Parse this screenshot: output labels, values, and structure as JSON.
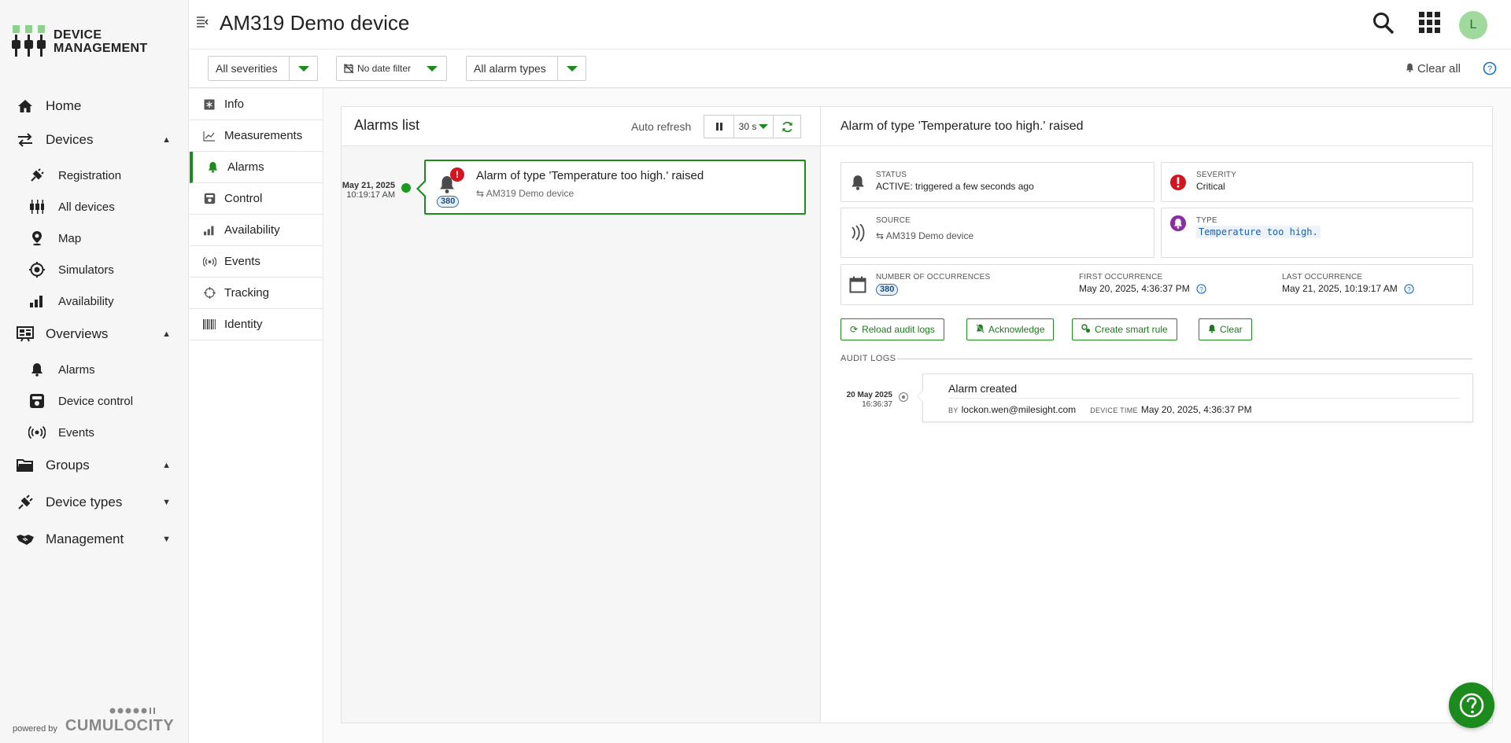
{
  "brand": {
    "line1": "DEVICE",
    "line2": "MANAGEMENT",
    "logo_color": "#8cd28c",
    "powered_by": "powered by",
    "powered_brand": "CUMULOCITY"
  },
  "nav": {
    "home": "Home",
    "devices": "Devices",
    "devices_sub": [
      "Registration",
      "All devices",
      "Map",
      "Simulators",
      "Availability"
    ],
    "overviews": "Overviews",
    "overviews_sub": [
      "Alarms",
      "Device control",
      "Events"
    ],
    "groups": "Groups",
    "device_types": "Device types",
    "management": "Management"
  },
  "header": {
    "title": "AM319 Demo device",
    "avatar_initial": "L",
    "icons": [
      "sidebar-collapse-icon",
      "search-icon",
      "app-grid-icon"
    ]
  },
  "filters": {
    "severity": "All severities",
    "date": "No date filter",
    "alarm_types": "All alarm types",
    "clear_all": "Clear all"
  },
  "tabs": [
    "Info",
    "Measurements",
    "Alarms",
    "Control",
    "Availability",
    "Events",
    "Tracking",
    "Identity"
  ],
  "active_tab": "Alarms",
  "alarms_list": {
    "title": "Alarms list",
    "auto_refresh_label": "Auto refresh",
    "interval": "30 s",
    "items": [
      {
        "date": "May 21, 2025",
        "time": "10:19:17 AM",
        "title": "Alarm of type 'Temperature too high.' raised",
        "source": "AM319 Demo device",
        "count": "380",
        "severity_mark": "!"
      }
    ]
  },
  "detail": {
    "title": "Alarm of type 'Temperature too high.' raised",
    "status_label": "STATUS",
    "status_value": "ACTIVE: triggered a few seconds ago",
    "severity_label": "SEVERITY",
    "severity_value": "Critical",
    "source_label": "SOURCE",
    "source_value": "AM319 Demo device",
    "type_label": "TYPE",
    "type_value": "Temperature too high.",
    "occurrences_label": "NUMBER OF OCCURRENCES",
    "occurrences_value": "380",
    "first_label": "FIRST OCCURRENCE",
    "first_value": "May 20, 2025, 4:36:37 PM",
    "last_label": "LAST OCCURRENCE",
    "last_value": "May 21, 2025, 10:19:17 AM",
    "buttons": {
      "reload": "Reload audit logs",
      "acknowledge": "Acknowledge",
      "smart_rule": "Create smart rule",
      "clear": "Clear"
    },
    "audit_label": "AUDIT LOGS",
    "audit": {
      "date": "20 May 2025",
      "time": "16:36:37",
      "title": "Alarm created",
      "by_label": "BY",
      "by_value": "lockon.wen@milesight.com",
      "device_time_label": "DEVICE TIME",
      "device_time_value": "May 20, 2025, 4:36:37 PM"
    }
  },
  "colors": {
    "accent": "#1c8a1c",
    "critical": "#d3151f",
    "type_badge": "#8b2fa0",
    "count_badge": "#2a6cb0"
  }
}
